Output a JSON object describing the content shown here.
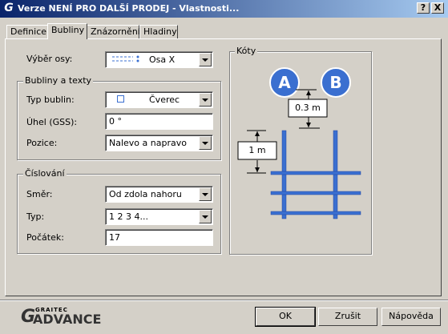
{
  "window": {
    "title": "Verze NENÍ PRO DALŠÍ PRODEJ - Vlastnosti...",
    "help_button": "?",
    "close_button": "X"
  },
  "tabs": [
    {
      "label": "Definice"
    },
    {
      "label": "Bubliny"
    },
    {
      "label": "Znázornění"
    },
    {
      "label": "Hladiny"
    }
  ],
  "axis_select": {
    "label": "Výběr osy:",
    "value": "Osa X"
  },
  "bubbles_group": {
    "title": "Bubliny a texty",
    "type": {
      "label": "Typ bublin:",
      "value": "Čverec"
    },
    "angle": {
      "label": "Úhel (GSS):",
      "value": "0 °"
    },
    "position": {
      "label": "Pozice:",
      "value": "Nalevo a napravo"
    }
  },
  "numbering_group": {
    "title": "Číslování",
    "direction": {
      "label": "Směr:",
      "value": "Od zdola nahoru"
    },
    "type": {
      "label": "Typ:",
      "value": "1 2 3 4..."
    },
    "start": {
      "label": "Počátek:",
      "value": "17"
    }
  },
  "dimensions": {
    "title": "Kóty",
    "bubble_a": "A",
    "bubble_b": "B",
    "offset_label": "0.3 m",
    "spacing_label": "1 m"
  },
  "footer": {
    "brand_top": "GRAITEC",
    "brand": "ADVANCE",
    "ok": "OK",
    "cancel": "Zrušit",
    "help": "Nápověda"
  },
  "colors": {
    "accent": "#3a6fd0",
    "title_bar": "#0a246a"
  }
}
